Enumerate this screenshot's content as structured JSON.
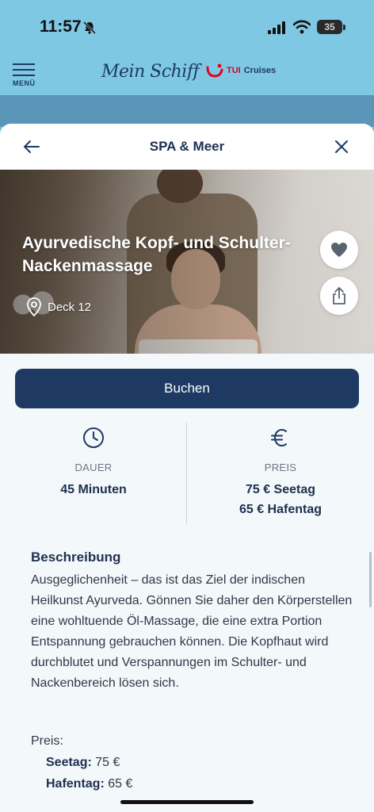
{
  "status_bar": {
    "time": "11:57",
    "battery": "35"
  },
  "app_header": {
    "menu_label": "MENÜ",
    "brand": "Mein Schiff",
    "partner_brand_tui": "TUI",
    "partner_brand_cruises": "Cruises",
    "brand_color": "#1e3a63",
    "partner_color": "#e2001a"
  },
  "sheet": {
    "title": "SPA & Meer",
    "back_icon": "arrow-left-icon",
    "close_icon": "close-icon"
  },
  "hero": {
    "title": "Ayurvedische Kopf- und Schulter-Nackenmassage",
    "location": "Deck 12",
    "favorite_icon": "heart-icon",
    "share_icon": "share-icon"
  },
  "actions": {
    "book_label": "Buchen",
    "book_color": "#1e3a63"
  },
  "info": {
    "duration_label": "DAUER",
    "duration_value": "45 Minuten",
    "price_label": "PREIS",
    "price_sea_day": "75 € Seetag",
    "price_port_day": "65 € Hafentag"
  },
  "description": {
    "heading": "Beschreibung",
    "text": "Ausgeglichenheit – das ist das Ziel der indischen Heilkunst Ayurveda. Gönnen Sie daher den Körperstellen eine wohltuende Öl-Massage, die eine extra Portion Entspannung gebrauchen können. Die Kopfhaut wird durchblutet und Verspannungen im Schulter- und Nackenbereich lösen sich.",
    "price_heading": "Preis:",
    "sea_day_label": "Seetag:",
    "sea_day_value": "75 €",
    "port_day_label": "Hafentag:",
    "port_day_value": "65 €"
  }
}
